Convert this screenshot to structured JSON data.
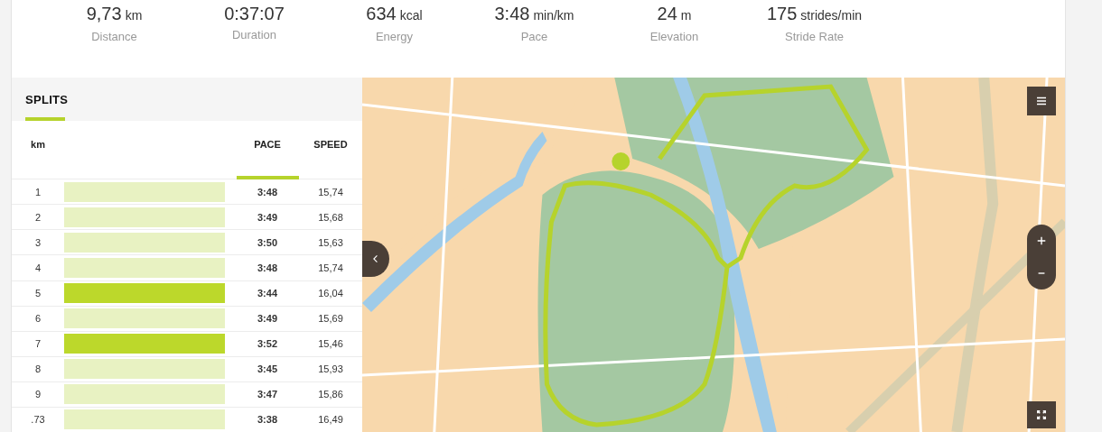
{
  "stats": [
    {
      "value": "9,73",
      "unit": "km",
      "label": "Distance"
    },
    {
      "value": "0:37:07",
      "label": "Duration"
    },
    {
      "value": "634",
      "unit": "kcal",
      "label": "Energy"
    },
    {
      "value": "3:48",
      "unit": "min/km",
      "label": "Pace"
    },
    {
      "value": "24",
      "unit": "m",
      "label": "Elevation"
    },
    {
      "value": "175",
      "unit": "strides/min",
      "label": "Stride Rate"
    }
  ],
  "splits": {
    "tab": {
      "label": "SPLITS",
      "selected": true
    },
    "columns": [
      {
        "label": "km",
        "sorted": false
      },
      {
        "label": "PACE",
        "sorted": true
      },
      {
        "label": "SPEED",
        "sorted": false
      }
    ],
    "rows": [
      {
        "km": "1",
        "highlighted": false,
        "pace": "3:48",
        "speed": "15,74"
      },
      {
        "km": "2",
        "highlighted": false,
        "pace": "3:49",
        "speed": "15,68"
      },
      {
        "km": "3",
        "highlighted": false,
        "pace": "3:50",
        "speed": "15,63"
      },
      {
        "km": "4",
        "highlighted": false,
        "pace": "3:48",
        "speed": "15,74"
      },
      {
        "km": "5",
        "highlighted": true,
        "pace": "3:44",
        "speed": "16,04"
      },
      {
        "km": "6",
        "highlighted": false,
        "pace": "3:49",
        "speed": "15,69"
      },
      {
        "km": "7",
        "highlighted": true,
        "pace": "3:52",
        "speed": "15,46"
      },
      {
        "km": "8",
        "highlighted": false,
        "pace": "3:45",
        "speed": "15,93"
      },
      {
        "km": "9",
        "highlighted": false,
        "pace": "3:47",
        "speed": "15,86"
      },
      {
        "km": ".73",
        "highlighted": false,
        "pace": "3:38",
        "speed": "16,49"
      }
    ]
  }
}
